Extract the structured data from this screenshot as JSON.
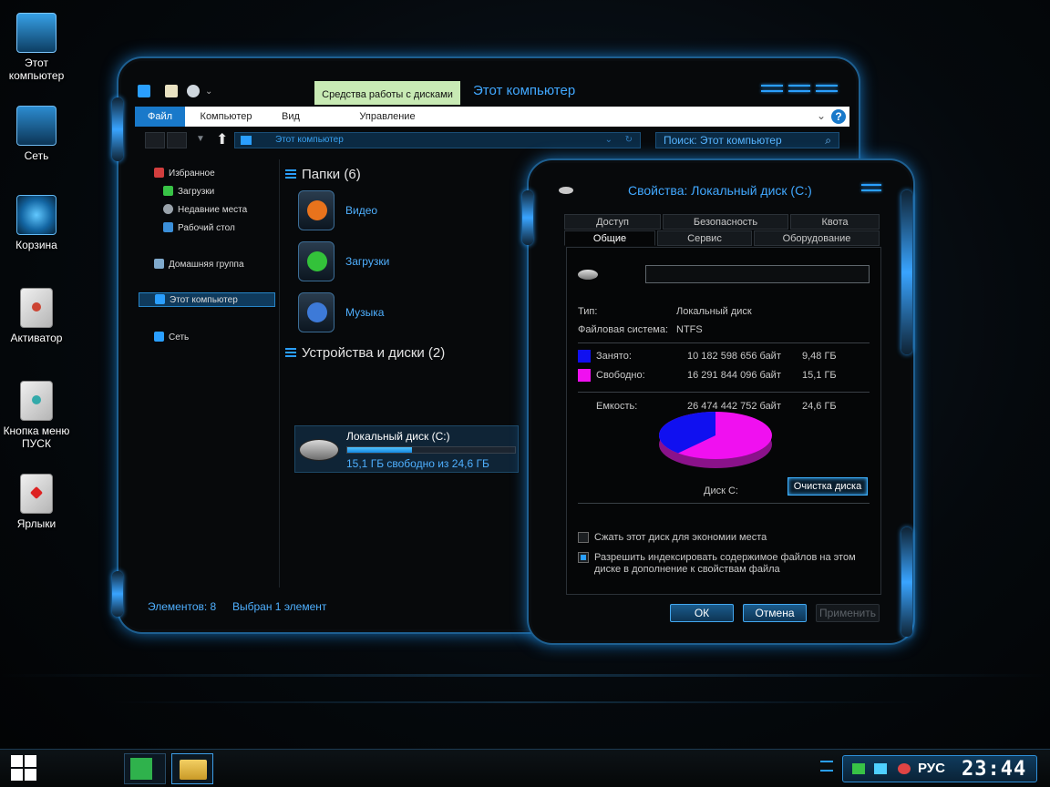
{
  "desktop": {
    "icons": [
      {
        "label": "Этот компьютер",
        "icon": "computer-icon"
      },
      {
        "label": "Сеть",
        "icon": "network-icon"
      },
      {
        "label": "Корзина",
        "icon": "recycle-bin-icon"
      },
      {
        "label": "Активатор",
        "icon": "document-icon"
      },
      {
        "label": "Кнопка меню ПУСК",
        "icon": "document-icon"
      },
      {
        "label": "Ярлыки",
        "icon": "document-icon"
      }
    ]
  },
  "explorer": {
    "contextual_tab": "Средства работы с дисками",
    "title": "Этот компьютер",
    "ribbon_tabs": [
      "Файл",
      "Компьютер",
      "Вид",
      "Управление"
    ],
    "help": "?",
    "address": "Этот компьютер",
    "search_placeholder": "Поиск: Этот компьютер",
    "nav": {
      "favorites": "Избранное",
      "downloads": "Загрузки",
      "recent": "Недавние места",
      "desktop": "Рабочий стол",
      "homegroup": "Домашняя группа",
      "this_pc": "Этот компьютер",
      "network": "Сеть"
    },
    "folders_header": "Папки (6)",
    "folders": [
      {
        "label": "Видео",
        "color": "#e8731c"
      },
      {
        "label": "Загрузки",
        "color": "#33c23a"
      },
      {
        "label": "Музыка",
        "color": "#3d7ad8"
      }
    ],
    "devices_header": "Устройства и диски (2)",
    "drive": {
      "name": "Локальный диск (C:)",
      "free_text": "15,1 ГБ свободно из 24,6 ГБ",
      "used_fraction": 0.385
    },
    "status_items": "Элементов: 8",
    "status_selected": "Выбран 1 элемент"
  },
  "properties": {
    "title": "Свойства: Локальный диск (C:)",
    "tabs_row1": [
      "Доступ",
      "Безопасность",
      "Квота"
    ],
    "tabs_row2": [
      "Общие",
      "Сервис",
      "Оборудование"
    ],
    "name_value": "",
    "type_label": "Тип:",
    "type_value": "Локальный диск",
    "fs_label": "Файловая система:",
    "fs_value": "NTFS",
    "used_label": "Занято:",
    "used_bytes": "10 182 598 656 байт",
    "used_gb": "9,48 ГБ",
    "free_label": "Свободно:",
    "free_bytes": "16 291 844 096 байт",
    "free_gb": "15,1 ГБ",
    "capacity_label": "Емкость:",
    "capacity_bytes": "26 474 442 752 байт",
    "capacity_gb": "24,6 ГБ",
    "disk_label": "Диск C:",
    "cleanup_button": "Очистка диска",
    "compress_label": "Сжать этот диск для экономии места",
    "compress_checked": false,
    "index_label_line1": "Разрешить индексировать содержимое файлов на этом",
    "index_label_line2": "диске в дополнение к свойствам файла",
    "index_checked": true,
    "ok": "ОК",
    "cancel": "Отмена",
    "apply": "Применить",
    "used_color": "#1010f0",
    "free_color": "#f010f0",
    "used_fraction": 0.385
  },
  "taskbar": {
    "language": "РУС",
    "clock": "23:44"
  }
}
